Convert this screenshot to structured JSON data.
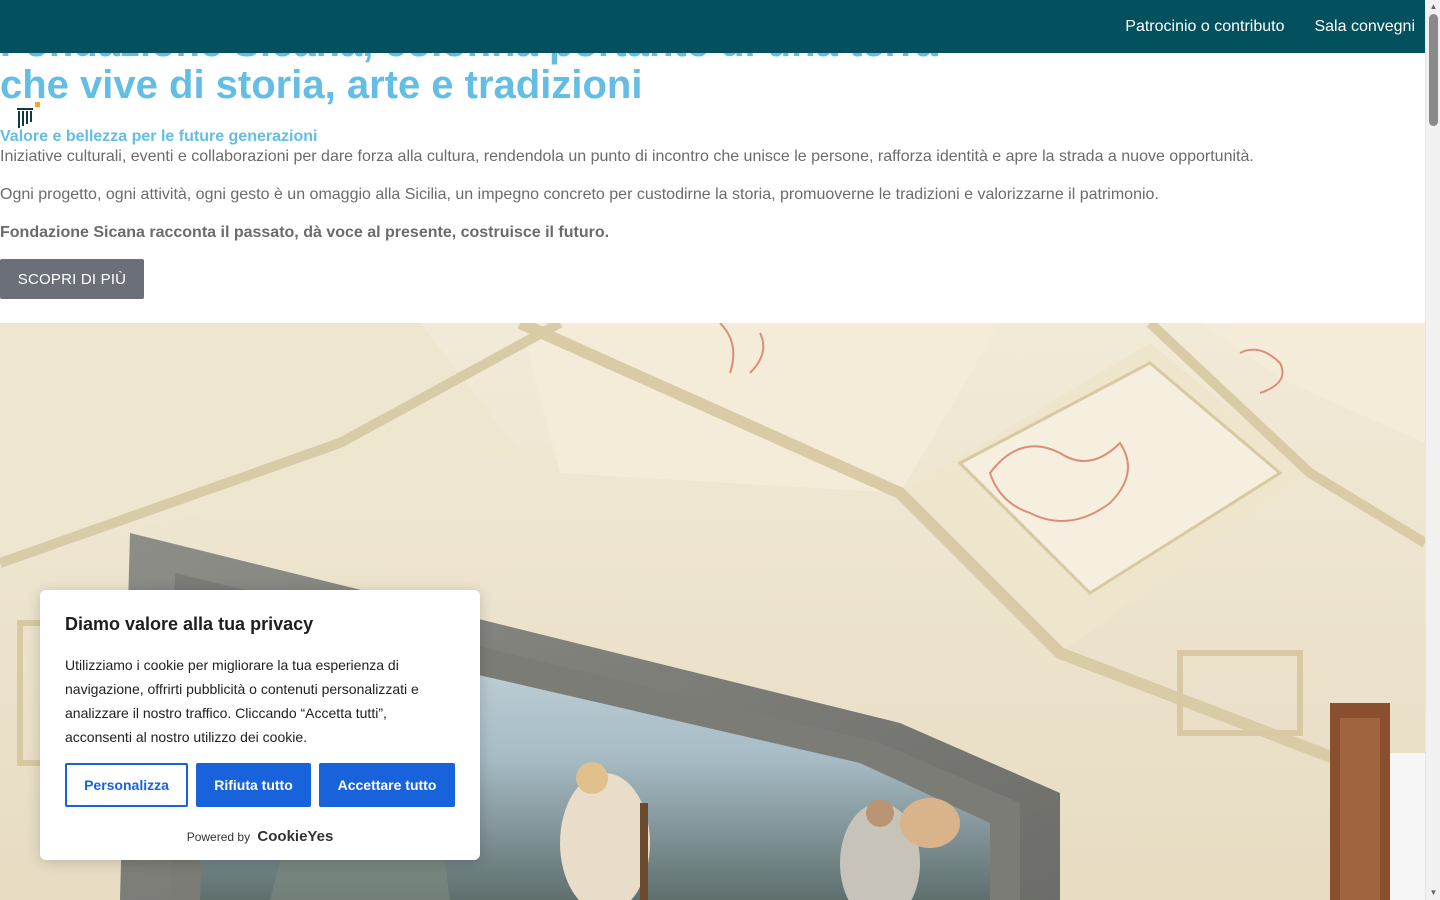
{
  "nav": {
    "items": [
      "Patrocinio o contributo",
      "Sala convegni"
    ]
  },
  "hero": {
    "title_line1": "Fondazione Sicana, colonna portante di una terra",
    "title_line2": "che vive di storia, arte e tradizioni",
    "subtitle": "Valore e bellezza per le future generazioni",
    "paragraph1": "Iniziative culturali, eventi e collaborazioni per dare forza alla cultura, rendendola un punto di incontro che unisce le persone, rafforza identità e apre la strada a nuove opportunità.",
    "paragraph2": "Ogni progetto, ogni attività, ogni gesto è un omaggio alla Sicilia, un impegno concreto per custodirne la storia, promuoverne le tradizioni e valorizzarne il patrimonio.",
    "paragraph3": "Fondazione Sicana racconta il passato, dà voce al presente, costruisce il futuro.",
    "cta_label": "SCOPRI DI PIÙ"
  },
  "cookie_banner": {
    "title": "Diamo valore alla tua privacy",
    "text": "Utilizziamo i cookie per migliorare la tua esperienza di navigazione, offrirti pubblicità o contenuti personalizzati e analizzare il nostro traffico. Cliccando “Accetta tutti”, acconsenti al nostro utilizzo dei cookie.",
    "customize_label": "Personalizza",
    "reject_label": "Rifiuta tutto",
    "accept_label": "Accettare tutto",
    "powered_by": "Powered by",
    "brand": "CookieYes"
  },
  "colors": {
    "header_bg": "#03505f",
    "accent_blue": "#63bde5",
    "cookie_button": "#1863dc",
    "cta_bg": "#6b7078"
  },
  "icons": [
    "logo-icon",
    "scroll-up-icon",
    "scroll-down-icon"
  ]
}
